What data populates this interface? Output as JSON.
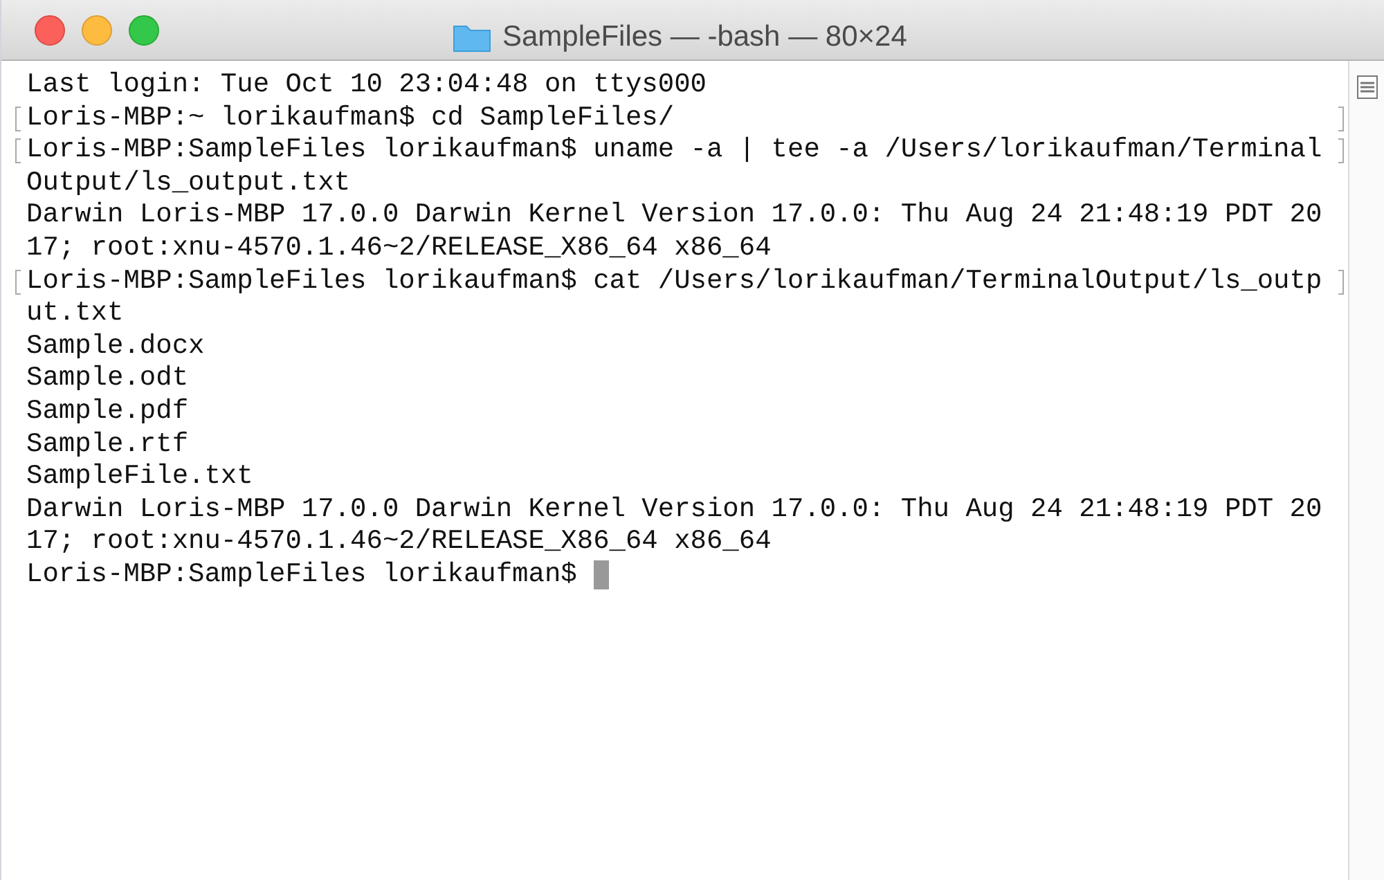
{
  "window": {
    "title": "SampleFiles — -bash — 80×24"
  },
  "terminal": {
    "lines": [
      {
        "text": "Last login: Tue Oct 10 23:04:48 on ttys000",
        "marked": false
      },
      {
        "text": "Loris-MBP:~ lorikaufman$ cd SampleFiles/",
        "marked": true
      },
      {
        "text": "Loris-MBP:SampleFiles lorikaufman$ uname -a | tee -a /Users/lorikaufman/Terminal",
        "marked": true
      },
      {
        "text": "Output/ls_output.txt",
        "marked": false
      },
      {
        "text": "Darwin Loris-MBP 17.0.0 Darwin Kernel Version 17.0.0: Thu Aug 24 21:48:19 PDT 20",
        "marked": false
      },
      {
        "text": "17; root:xnu-4570.1.46~2/RELEASE_X86_64 x86_64",
        "marked": false
      },
      {
        "text": "Loris-MBP:SampleFiles lorikaufman$ cat /Users/lorikaufman/TerminalOutput/ls_outp",
        "marked": true
      },
      {
        "text": "ut.txt",
        "marked": false
      },
      {
        "text": "Sample.docx",
        "marked": false
      },
      {
        "text": "Sample.odt",
        "marked": false
      },
      {
        "text": "Sample.pdf",
        "marked": false
      },
      {
        "text": "Sample.rtf",
        "marked": false
      },
      {
        "text": "SampleFile.txt",
        "marked": false
      },
      {
        "text": "Darwin Loris-MBP 17.0.0 Darwin Kernel Version 17.0.0: Thu Aug 24 21:48:19 PDT 20",
        "marked": false
      },
      {
        "text": "17; root:xnu-4570.1.46~2/RELEASE_X86_64 x86_64",
        "marked": false
      },
      {
        "text": "Loris-MBP:SampleFiles lorikaufman$",
        "marked": false
      }
    ],
    "cursor": true
  }
}
